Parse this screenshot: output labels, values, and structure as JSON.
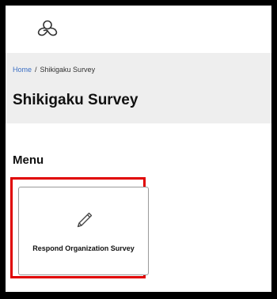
{
  "brand": {
    "logo_icon": "knot-logo-icon"
  },
  "breadcrumb": {
    "home": "Home",
    "separator": "/",
    "current": "Shikigaku Survey"
  },
  "page": {
    "title": "Shikigaku Survey"
  },
  "menu": {
    "title": "Menu",
    "items": [
      {
        "label": "Respond Organization Survey",
        "icon": "pencil-icon"
      }
    ]
  },
  "colors": {
    "link": "#3b6fc4",
    "header_bg": "#eeeeee",
    "highlight": "#e00000"
  }
}
